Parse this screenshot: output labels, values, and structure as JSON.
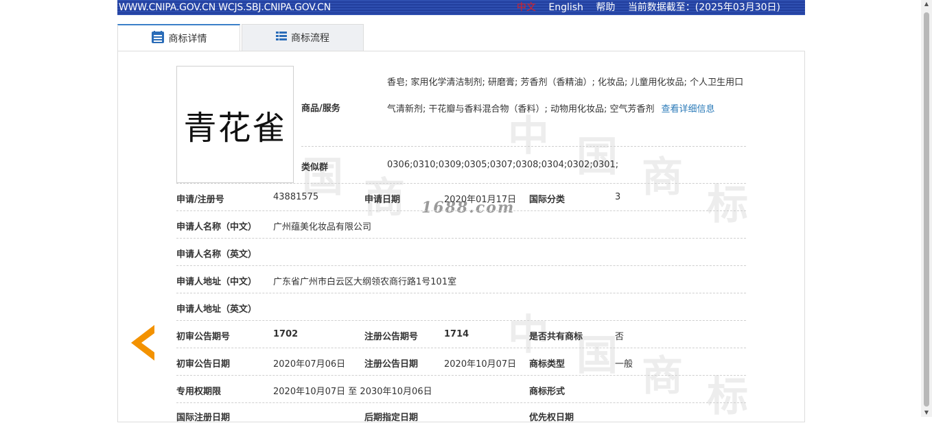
{
  "topbar": {
    "sites": "WWW.CNIPA.GOV.CN WCJS.SBJ.CNIPA.GOV.CN",
    "lang_zh": "中文",
    "lang_en": "English",
    "help": "帮助",
    "data_as_of": "当前数据截至：(2025年03月30日)"
  },
  "tabs": [
    {
      "label": "商标详情",
      "icon": "document-list-icon"
    },
    {
      "label": "商标流程",
      "icon": "list-icon"
    }
  ],
  "watermark": "1688.com",
  "logo_text": "青花雀",
  "detail": {
    "goods_label": "商品/服务",
    "goods_text": "香皂; 家用化学清洁制剂; 研磨膏; 芳香剂（香精油）; 化妆品; 儿童用化妆品; 个人卫生用口气清新剂; 干花瓣与香料混合物（香料）; 动物用化妆品; 空气芳香剂",
    "goods_link": "查看详细信息",
    "similar_label": "类似群",
    "similar_value": "0306;0310;0309;0305;0307;0308;0304;0302;0301;",
    "reg_no_label": "申请/注册号",
    "reg_no": "43881575",
    "app_date_label": "申请日期",
    "app_date": "2020年01月17日",
    "intl_class_label": "国际分类",
    "intl_class": "3",
    "applicant_cn_label": "申请人名称（中文）",
    "applicant_cn": "广州蕴美化妆品有限公司",
    "applicant_en_label": "申请人名称（英文）",
    "applicant_en": "",
    "address_cn_label": "申请人地址（中文）",
    "address_cn": "广东省广州市白云区大纲领农商行路1号101室",
    "address_en_label": "申请人地址（英文）",
    "address_en": "",
    "prelim_no_label": "初审公告期号",
    "prelim_no": "1702",
    "reg_pub_no_label": "注册公告期号",
    "reg_pub_no": "1714",
    "shared_label": "是否共有商标",
    "shared": "否",
    "prelim_date_label": "初审公告日期",
    "prelim_date": "2020年07月06日",
    "reg_pub_date_label": "注册公告日期",
    "reg_pub_date": "2020年10月07日",
    "type_label": "商标类型",
    "type": "一般",
    "term_label": "专用权期限",
    "term": "2020年10月07日 至 2030年10月06日",
    "form_label": "商标形式",
    "form": "",
    "intl_reg_date_label": "国际注册日期",
    "later_designation_label": "后期指定日期",
    "priority_date_label": "优先权日期"
  },
  "colors": {
    "topbar": "#223f9e",
    "link": "#2a7ab8",
    "arrow": "#f39200"
  }
}
